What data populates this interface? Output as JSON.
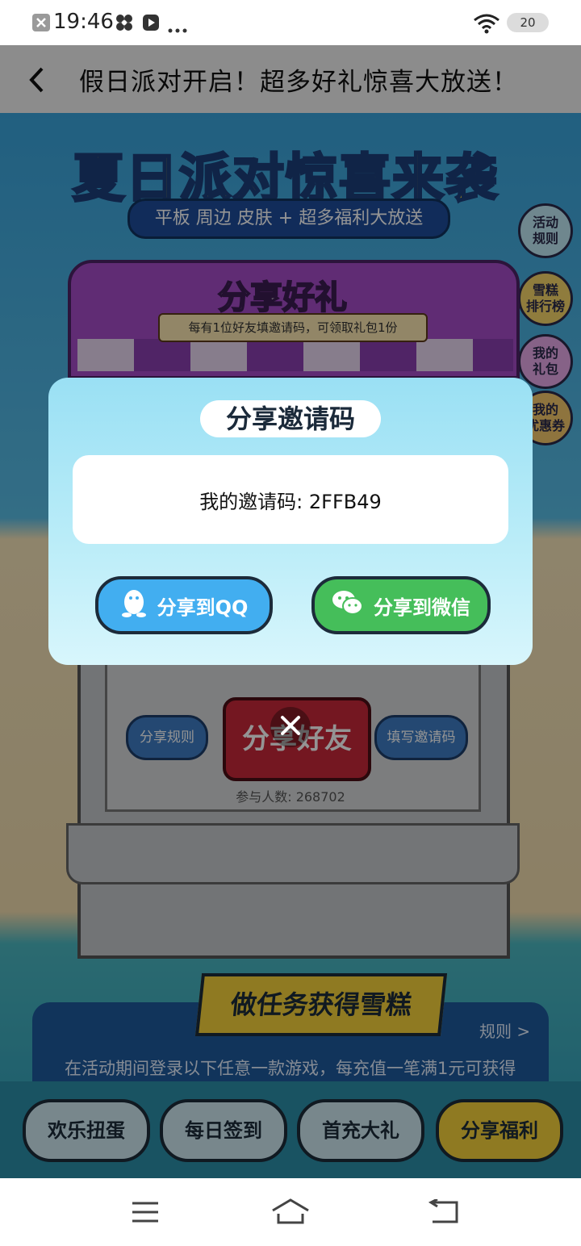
{
  "status_bar": {
    "time": "19:46",
    "battery": "20",
    "icons": [
      "notification-x-icon",
      "pinwheel-icon",
      "play-icon",
      "more-dots-icon",
      "wifi-icon"
    ]
  },
  "title_bar": {
    "title": "假日派对开启！超多好礼惊喜大放送！"
  },
  "banner": {
    "title": "夏日派对惊喜来袭",
    "subtitle": "平板 周边 皮肤 + 超多福利大放送"
  },
  "side_buttons": [
    {
      "label": "活动\n规则"
    },
    {
      "label": "雪糕\n排行榜"
    },
    {
      "label": "我的\n礼包"
    },
    {
      "label": "我的\n优惠券"
    }
  ],
  "share_section": {
    "title": "分享好礼",
    "description": "每有1位好友填邀请码，可领取礼包1份",
    "share_rules": "分享规则",
    "share_friends": "分享好友",
    "fill_code": "填写邀请码",
    "participants": "参与人数: 268702"
  },
  "task_section": {
    "title": "做任务获得雪糕",
    "rules_link": "规则 >",
    "description": "在活动期间登录以下任意一款游戏，每充值一笔满1元可获得"
  },
  "bottom_tabs": [
    "欢乐扭蛋",
    "每日签到",
    "首充大礼",
    "分享福利"
  ],
  "dialog": {
    "title": "分享邀请码",
    "code_text": "我的邀请码: 2FFB49",
    "share_qq": "分享到QQ",
    "share_wechat": "分享到微信"
  },
  "colors": {
    "dialog_bg": "#b9ecf8",
    "qq_button": "#42aef0",
    "wechat_button": "#45be5a"
  }
}
